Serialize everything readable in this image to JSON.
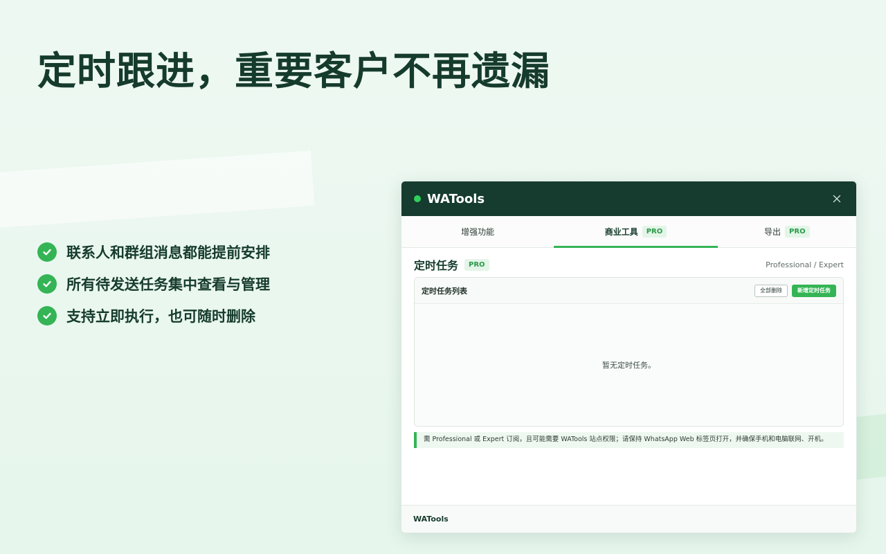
{
  "hero": {
    "title": "定时跟进，重要客户不再遗漏"
  },
  "features": [
    {
      "icon": "check-circle-icon",
      "text": "联系人和群组消息都能提前安排"
    },
    {
      "icon": "check-circle-icon",
      "text": "所有待发送任务集中查看与管理"
    },
    {
      "icon": "check-circle-icon",
      "text": "支持立即执行，也可随时删除"
    }
  ],
  "window": {
    "title": "WATools",
    "tabs": [
      {
        "label": "增强功能",
        "badge": ""
      },
      {
        "label": "商业工具",
        "badge": "PRO",
        "active": true
      },
      {
        "label": "导出",
        "badge": "PRO"
      }
    ],
    "section": {
      "title": "定时任务",
      "badge": "PRO",
      "plan": "Professional / Expert"
    },
    "panel": {
      "title": "定时任务列表",
      "delete_all": "全部删除",
      "add_task": "新增定时任务",
      "empty": "暂无定时任务。"
    },
    "notice": "需 Professional 或 Expert 订阅，且可能需要 WATools 站点权限；请保持 WhatsApp Web 标签页打开，并确保手机和电脑联网、开机。",
    "footer": "WATools"
  },
  "colors": {
    "accent": "#34b455",
    "header": "#153c2e",
    "dot": "#2fd05b"
  }
}
